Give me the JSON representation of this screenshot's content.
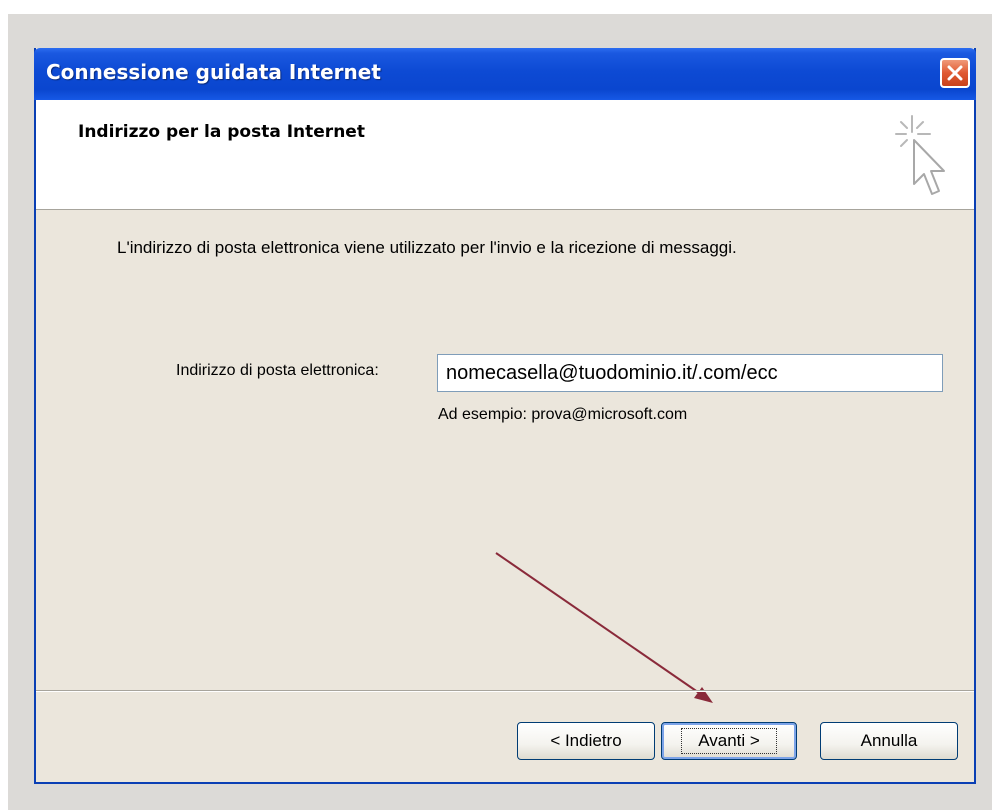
{
  "window": {
    "title": "Connessione guidata Internet"
  },
  "header": {
    "title": "Indirizzo per la posta Internet",
    "icon": "wizard-cursor-icon"
  },
  "body": {
    "description": "L'indirizzo di posta elettronica viene utilizzato per l'invio e la ricezione di messaggi.",
    "email_label": "Indirizzo di posta elettronica:",
    "email_value": "nomecasella@tuodominio.it/.com/ecc",
    "example": "Ad esempio: prova@microsoft.com"
  },
  "buttons": {
    "back": "< Indietro",
    "next": "Avanti >",
    "cancel": "Annulla"
  },
  "colors": {
    "titlebar": "#0a46cf",
    "window_bg": "#ebe6dc",
    "annotation_arrow": "#8a2a3a",
    "close_button": "#e05a32"
  }
}
